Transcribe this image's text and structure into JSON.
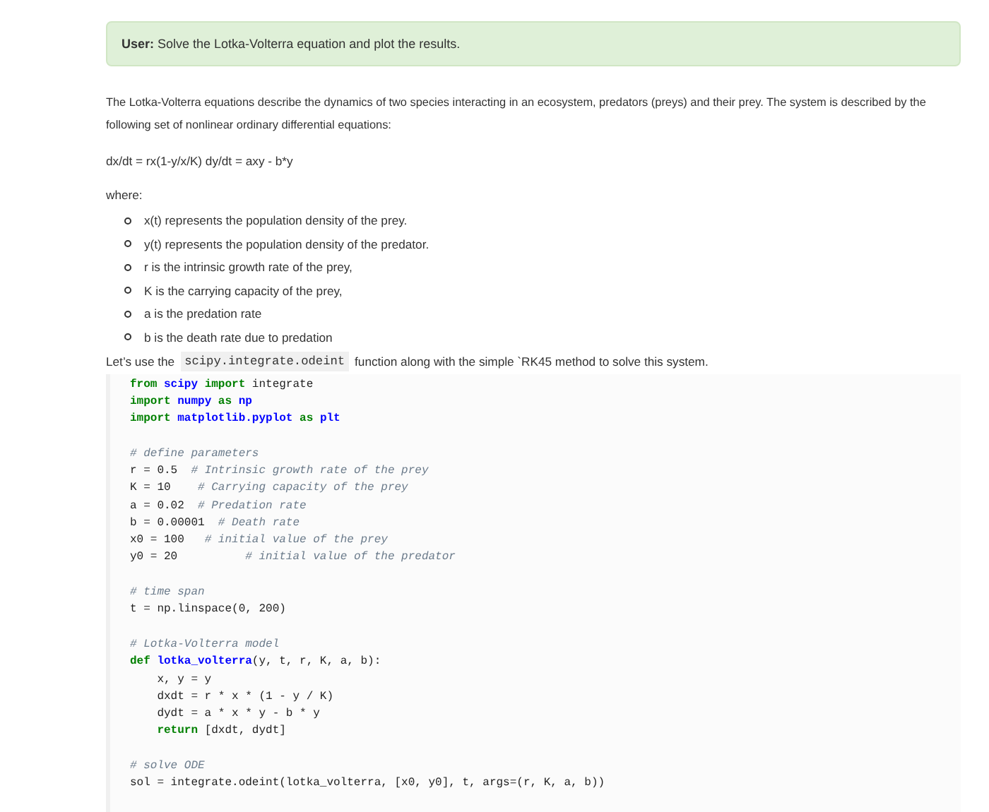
{
  "prompt": {
    "speaker": "User:",
    "text": "Solve the Lotka-Volterra equation and plot the results."
  },
  "intro": "The Lotka-Volterra equations describe the dynamics of two species interacting in an ecosystem, predators (preys) and their prey. The system is described by the following set of nonlinear ordinary differential equations:",
  "equation": "dx/dt = rx(1-y/x/K) dy/dt = axy - b*y",
  "where_label": "where:",
  "bullets": [
    "x(t) represents the population density of the prey.",
    "y(t) represents the population density of the predator.",
    "r is the intrinsic growth rate of the prey,",
    "K is the carrying capacity of the prey,",
    "a is the predation rate",
    "b is the death rate due to predation"
  ],
  "usage": {
    "before": "Let’s use the",
    "code": "scipy.integrate.odeint",
    "after": "function along with the simple `RK45 method to solve this system."
  },
  "code_blocks": [
    [
      [
        {
          "t": "from",
          "kind": "keyword"
        },
        {
          "t": " scipy",
          "kind": "name"
        },
        {
          "t": " import",
          "kind": "keyword"
        },
        {
          "t": " integrate"
        }
      ],
      [
        {
          "t": "import",
          "kind": "keyword"
        },
        {
          "t": " numpy",
          "kind": "name"
        },
        {
          "t": " as",
          "kind": "keyword"
        },
        {
          "t": " np",
          "kind": "name"
        }
      ],
      [
        {
          "t": "import",
          "kind": "keyword"
        },
        {
          "t": " matplotlib.pyplot",
          "kind": "name"
        },
        {
          "t": " as",
          "kind": "keyword"
        },
        {
          "t": " plt",
          "kind": "name"
        }
      ]
    ],
    [
      [
        {
          "t": "# define parameters",
          "kind": "comment"
        }
      ],
      [
        {
          "t": "r = 0.5  "
        },
        {
          "t": "# Intrinsic growth rate of the prey",
          "kind": "comment"
        }
      ],
      [
        {
          "t": "K = 10    "
        },
        {
          "t": "# Carrying capacity of the prey",
          "kind": "comment"
        }
      ],
      [
        {
          "t": "a = 0.02  "
        },
        {
          "t": "# Predation rate",
          "kind": "comment"
        }
      ],
      [
        {
          "t": "b = 0.00001  "
        },
        {
          "t": "# Death rate",
          "kind": "comment"
        }
      ],
      [
        {
          "t": "x0 = 100   "
        },
        {
          "t": "# initial value of the prey",
          "kind": "comment"
        }
      ],
      [
        {
          "t": "y0 = 20          "
        },
        {
          "t": "# initial value of the predator",
          "kind": "comment"
        }
      ]
    ],
    [
      [
        {
          "t": "# time span",
          "kind": "comment"
        }
      ],
      [
        {
          "t": "t = np.linspace(0, 200)"
        }
      ]
    ],
    [
      [
        {
          "t": "# Lotka-Volterra model",
          "kind": "comment"
        }
      ],
      [
        {
          "t": "def",
          "kind": "keyword"
        },
        {
          "t": " lotka_volterra",
          "kind": "name"
        },
        {
          "t": "(y, t, r, K, a, b):"
        }
      ],
      [
        {
          "t": "    x, y = y"
        }
      ],
      [
        {
          "t": "    dxdt = r * x * (1 - y / K)"
        }
      ],
      [
        {
          "t": "    dydt = a * x * y - b * y"
        }
      ],
      [
        {
          "t": "    return",
          "kind": "keyword"
        },
        {
          "t": " [dxdt, dydt]"
        }
      ]
    ],
    [
      [
        {
          "t": "# solve ODE",
          "kind": "comment"
        }
      ],
      [
        {
          "t": "sol = integrate.odeint(lotka_volterra, [x0, y0], t, args=(r, K, a, b))"
        }
      ]
    ]
  ]
}
